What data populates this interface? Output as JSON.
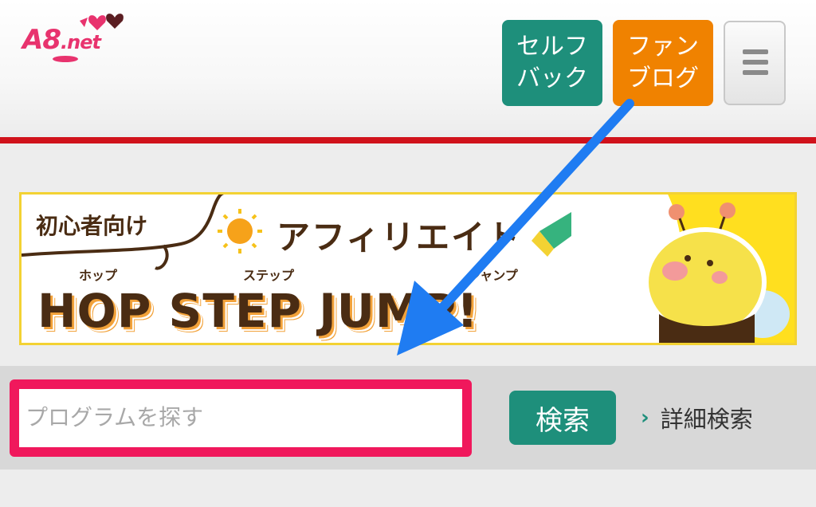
{
  "header": {
    "logo": {
      "text_main": "A8",
      "text_sub": ".net",
      "color": "#e8336e"
    },
    "buttons": [
      {
        "label_line1": "セルフ",
        "label_line2": "バック",
        "color": "#1e8f7b"
      },
      {
        "label_line1": "ファン",
        "label_line2": "ブログ",
        "color": "#f08200"
      }
    ],
    "menu_icon": "hamburger-icon",
    "accent_line_color": "#d0121b"
  },
  "banner": {
    "subtitle": "初心者向け",
    "title": "アフィリエイト",
    "ruby": [
      "ホップ",
      "ステップ",
      "ジャンプ"
    ],
    "main": "HOP STEP JUMP!",
    "icons": [
      "sun-icon",
      "beginner-mark-icon",
      "bee-mascot-icon"
    ]
  },
  "search": {
    "placeholder": "プログラムを探す",
    "value": "",
    "button_label": "検索",
    "button_color": "#1e8f7b",
    "advanced_link": "詳細検索",
    "highlight_color": "#f0185c"
  },
  "annotation": {
    "arrow_color": "#1f7cf2"
  }
}
